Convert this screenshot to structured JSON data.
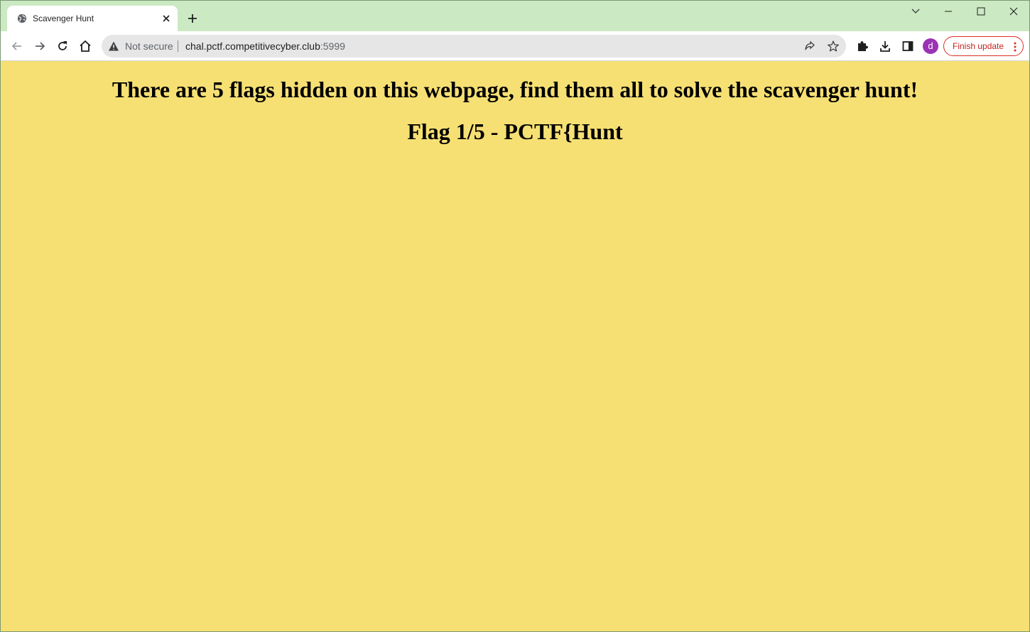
{
  "tab": {
    "title": "Scavenger Hunt",
    "favicon": "globe-icon"
  },
  "omnibox": {
    "security_label": "Not secure",
    "url_host": "chal.pctf.competitivecyber.club",
    "url_port": ":5999"
  },
  "profile": {
    "initial": "d",
    "color": "#9b33b5"
  },
  "update_button": {
    "label": "Finish update"
  },
  "page": {
    "background": "#f6e073",
    "heading": "There are 5 flags hidden on this webpage, find them all to solve the scavenger hunt!",
    "flag_heading": "Flag 1/5 - PCTF{Hunt"
  }
}
